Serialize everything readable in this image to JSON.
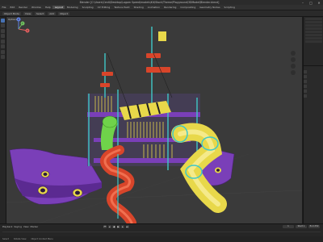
{
  "window": {
    "title": "Blender [C:\\Users\\Cenit\\Desktop\\Lagom Speed\\models\\Kit\\Stock\\Theme\\Playground\\3DModel\\Blender.blend]",
    "min_glyph": "–",
    "max_glyph": "□",
    "close_glyph": "✕"
  },
  "menubar": {
    "items": [
      "File",
      "Edit",
      "Render",
      "Window",
      "Help",
      "Layout",
      "Modeling",
      "Sculpting",
      "UV Editing",
      "Texture Paint",
      "Shading",
      "Animation",
      "Rendering",
      "Compositing",
      "Geometry Nodes",
      "Scripting"
    ],
    "active_index": 5
  },
  "toolbar": {
    "mode": "Object Mode",
    "view": "View",
    "select": "Select",
    "add": "Add",
    "object": "Object"
  },
  "viewport": {
    "overlay_label": "Options",
    "axis_x": "X",
    "axis_y": "Y",
    "axis_z": "Z"
  },
  "timeline": {
    "playback": "Playback",
    "keying": "Keying",
    "view": "View",
    "marker": "Marker",
    "start_label": "Start",
    "start": "1",
    "end_label": "End",
    "end": "250",
    "current": "1"
  },
  "statusbar": {
    "select": "Select",
    "rotate": "Rotate View",
    "context": "Object Context Menu"
  },
  "colors": {
    "viewport_bg": "#3a3a3a",
    "purple_ship": "#7a3fb8",
    "yellow_slide": "#e8d84a",
    "red_spiral": "#d8452a",
    "cyan_poles": "#3fc8c8",
    "green_tube": "#6fd34a",
    "accent": "#4772b3"
  }
}
